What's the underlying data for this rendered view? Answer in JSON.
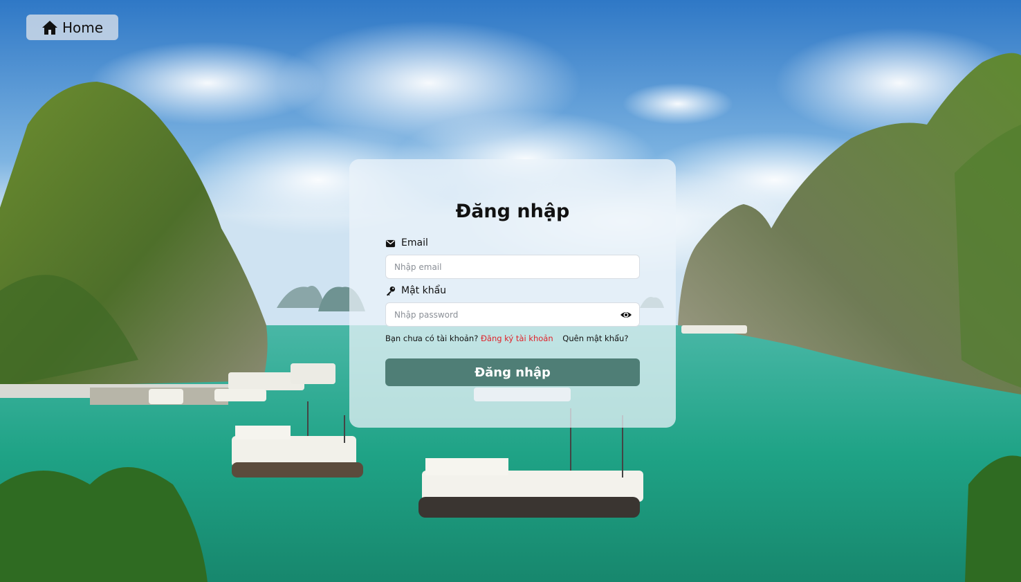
{
  "nav": {
    "home_label": "Home"
  },
  "login": {
    "title": "Đăng nhập",
    "email_label": "Email",
    "email_placeholder": "Nhập email",
    "password_label": "Mật khẩu",
    "password_placeholder": "Nhập password",
    "no_account_text": "Bạn chưa có tài khoản?",
    "register_link": "Đăng ký tài khoản",
    "forgot_link": "Quên mật khẩu?",
    "submit_label": "Đăng nhập"
  },
  "icons": {
    "home": "home-icon",
    "email": "email-icon",
    "password": "key-icon",
    "toggle": "eye-icon"
  },
  "colors": {
    "submit_bg": "#4f7e76",
    "register_link": "#e0222a"
  }
}
